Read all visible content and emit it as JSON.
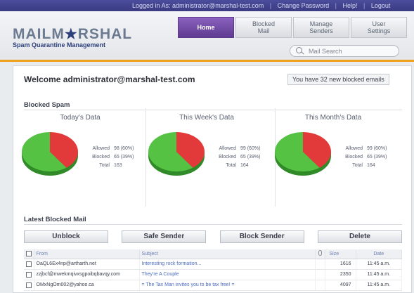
{
  "topbar": {
    "logged_in": "Logged in As: administrator@marshal-test.com",
    "change_password": "Change Password",
    "help": "Help!",
    "logout": "Logout"
  },
  "brand": {
    "name_left": "MAILM",
    "name_star": "★",
    "name_right": "RSHAL",
    "subtitle": "Spam Quarantine Management"
  },
  "nav": {
    "home": "Home",
    "blocked_mail": "Blocked\nMail",
    "manage_senders": "Manage\nSenders",
    "user_settings": "User\nSettings"
  },
  "search": {
    "placeholder": "Mail Search"
  },
  "welcome": "Welcome administrator@marshal-test.com",
  "new_blocked": "You have 32 new blocked emails",
  "blocked_spam_title": "Blocked Spam",
  "colors": {
    "allowed": "#55c244",
    "blocked": "#e23a3a",
    "accent": "#f0a11c",
    "nav_active": "#6b46a3"
  },
  "charts": [
    {
      "title": "Today's Data",
      "allowed_label": "Allowed",
      "allowed": "98 (60%)",
      "blocked_label": "Blocked",
      "blocked": "65 (39%)",
      "total_label": "Total",
      "total": "163",
      "allowed_pct": 60
    },
    {
      "title": "This Week's Data",
      "allowed_label": "Allowed",
      "allowed": "99 (60%)",
      "blocked_label": "Blocked",
      "blocked": "65 (39%)",
      "total_label": "Total",
      "total": "164",
      "allowed_pct": 60
    },
    {
      "title": "This Month's Data",
      "allowed_label": "Allowed",
      "allowed": "99 (60%)",
      "blocked_label": "Blocked",
      "blocked": "65 (39%)",
      "total_label": "Total",
      "total": "164",
      "allowed_pct": 60
    }
  ],
  "latest_title": "Latest Blocked Mail",
  "actions": {
    "unblock": "Unblock",
    "safe_sender": "Safe Sender",
    "block_sender": "Block Sender",
    "delete": "Delete"
  },
  "table": {
    "headers": {
      "from": "From",
      "subject": "Subject",
      "size": "Size",
      "date": "Date"
    },
    "rows": [
      {
        "from": "OaQL6Ex4np@artharth.net",
        "subject": "Interesting rock formation...",
        "size": "1616",
        "date": "11:45 a.m."
      },
      {
        "from": "zzjbcf@mwekmqivxsgpoibqbavqy.com",
        "subject": "They're A Couple",
        "size": "2350",
        "date": "11:45 a.m."
      },
      {
        "from": "OMxNgOm002@yahoo.ca",
        "subject": "= The Tax Man invites you to be tax free! =",
        "size": "4097",
        "date": "11:45 a.m."
      }
    ]
  }
}
